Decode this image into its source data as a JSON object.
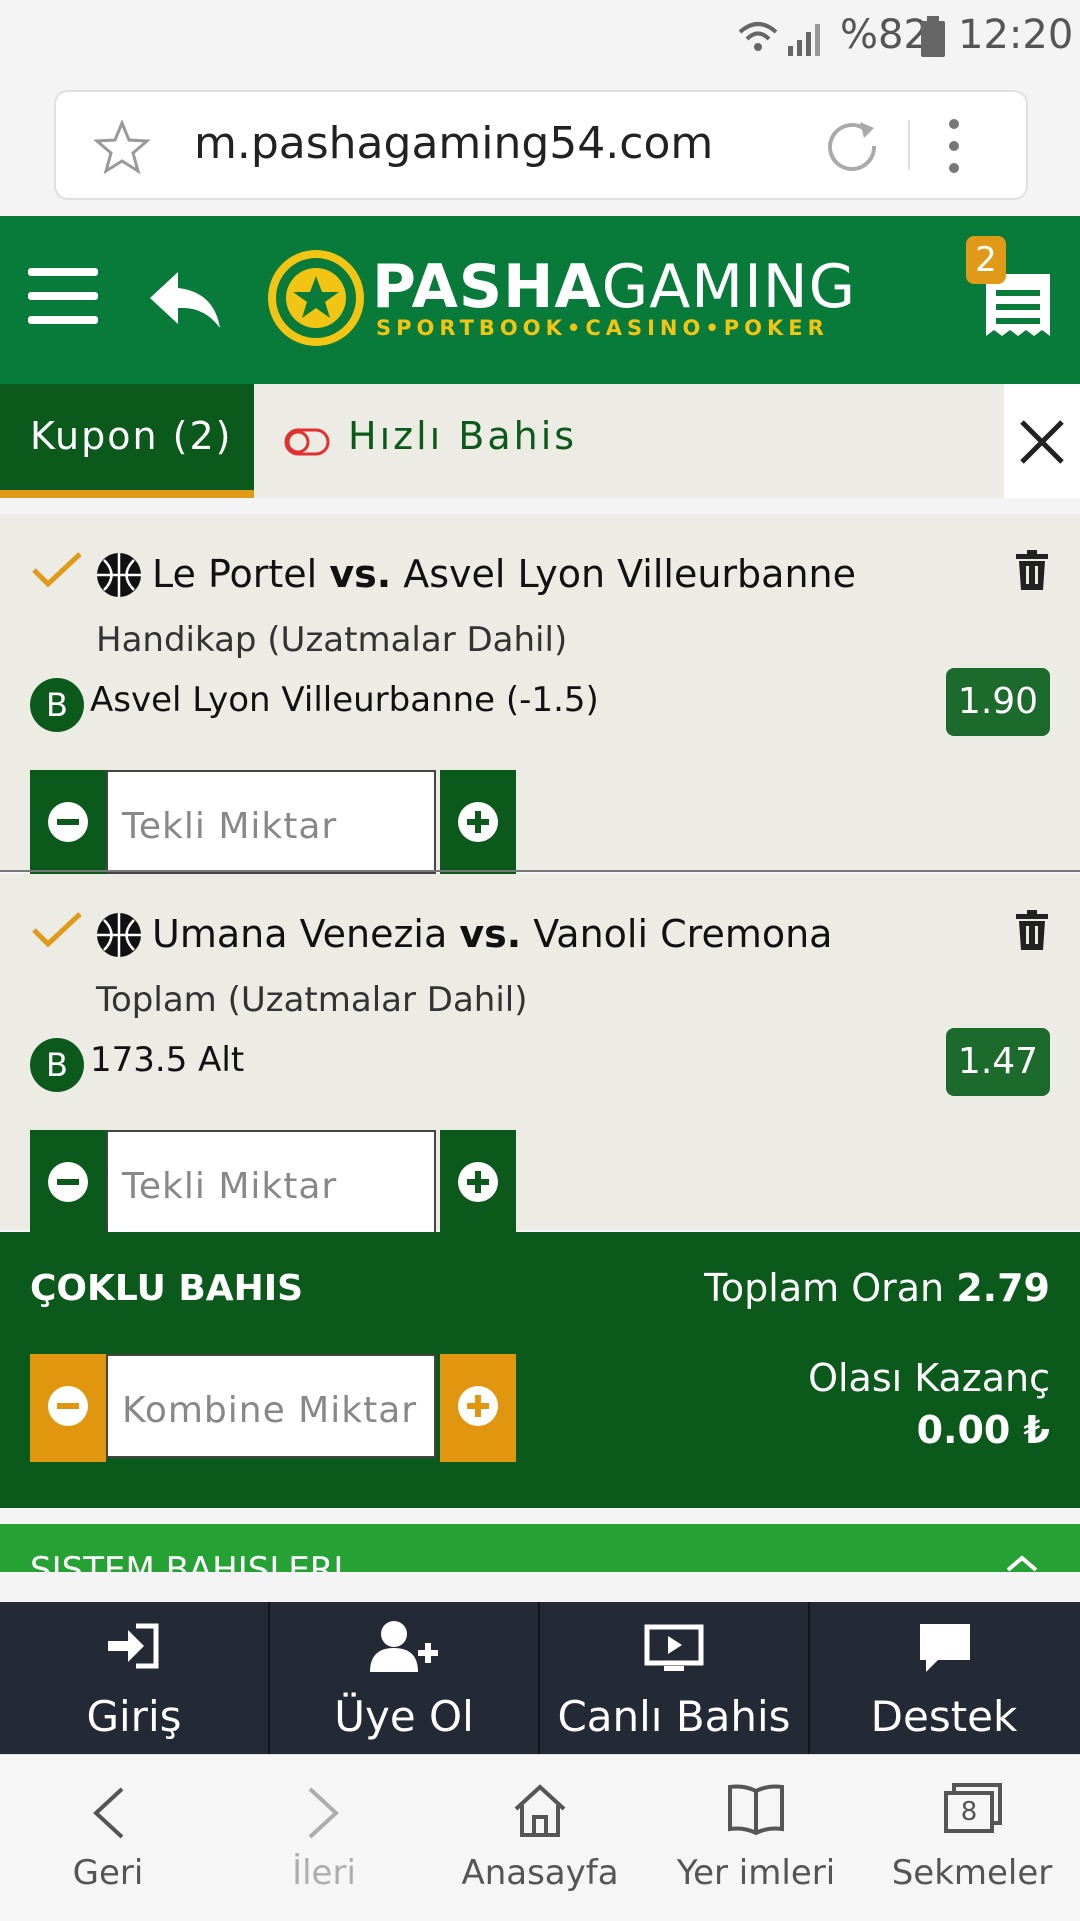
{
  "status_bar": {
    "battery": "%82",
    "time": "12:20"
  },
  "browser": {
    "url": "m.pashagaming54.com"
  },
  "header": {
    "brand_main": "PASHA",
    "brand_rest": "GAMING",
    "brand_sub": "SPORTBOOK•CASINO•POKER",
    "coupon_count": "2"
  },
  "tabs": {
    "kupon": "Kupon (2)",
    "hizli": "Hızlı Bahis"
  },
  "coupons": [
    {
      "team1": "Le Portel",
      "vs": "vs.",
      "team2": "Asvel Lyon Villeurbanne",
      "market": "Handikap (Uzatmalar Dahil)",
      "badge": "B",
      "selection": "Asvel Lyon Villeurbanne (-1.5)",
      "odds": "1.90",
      "stake_placeholder": "Tekli Miktar"
    },
    {
      "team1": "Umana Venezia",
      "vs": "vs.",
      "team2": "Vanoli Cremona",
      "market": "Toplam (Uzatmalar Dahil)",
      "badge": "B",
      "selection": "173.5 Alt",
      "odds": "1.47",
      "stake_placeholder": "Tekli Miktar"
    }
  ],
  "multi": {
    "label": "ÇOKLU BAHIS",
    "total_label": "Toplam Oran",
    "total_value": "2.79",
    "stake_placeholder": "Kombine Miktar",
    "win_label": "Olası Kazanç",
    "win_value": "0.00 ₺"
  },
  "system": {
    "label": "SISTEM BAHISLERI"
  },
  "site_nav": [
    {
      "label": "Giriş"
    },
    {
      "label": "Üye Ol"
    },
    {
      "label": "Canlı Bahis"
    },
    {
      "label": "Destek"
    }
  ],
  "browser_nav": [
    {
      "label": "Geri"
    },
    {
      "label": "İleri"
    },
    {
      "label": "Anasayfa"
    },
    {
      "label": "Yer imleri"
    },
    {
      "label": "Sekmeler",
      "badge": "8"
    }
  ],
  "colors": {
    "brand_green": "#087a3a",
    "dark_green": "#0b5a1c",
    "accent_orange": "#e09a17",
    "nav_dark": "#232a36"
  }
}
